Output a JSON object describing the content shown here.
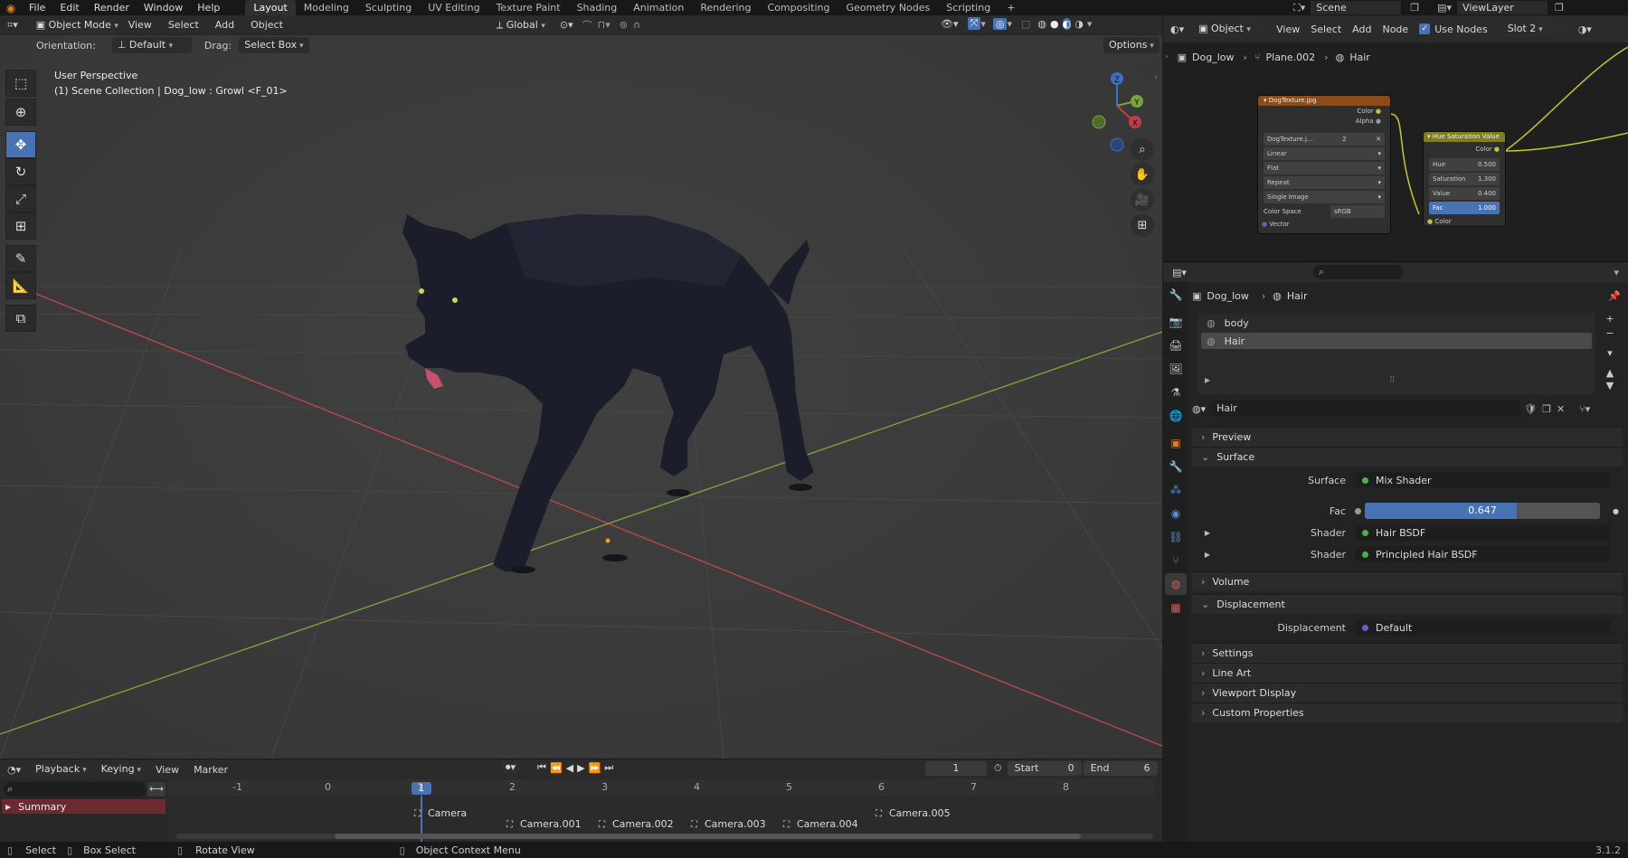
{
  "topbar": {
    "menus": [
      "File",
      "Edit",
      "Render",
      "Window",
      "Help"
    ],
    "workspaces": [
      "Layout",
      "Modeling",
      "Sculpting",
      "UV Editing",
      "Texture Paint",
      "Shading",
      "Animation",
      "Rendering",
      "Compositing",
      "Geometry Nodes",
      "Scripting"
    ],
    "active_workspace": "Layout",
    "add_tab": "+",
    "scene": "Scene",
    "view_layer": "ViewLayer"
  },
  "viewport": {
    "mode": "Object Mode",
    "menus": [
      "View",
      "Select",
      "Add",
      "Object"
    ],
    "transform": "Global",
    "orientation_label": "Orientation:",
    "orientation_value": "Default",
    "drag_label": "Drag:",
    "drag_value": "Select Box",
    "options": "Options",
    "overlay_line1": "User Perspective",
    "overlay_line2": "(1) Scene Collection | Dog_low : Growl <F_01>",
    "gizmo": {
      "x": "X",
      "y": "Y",
      "z": "Z"
    }
  },
  "timeline": {
    "menus": [
      "Playback",
      "Keying",
      "View",
      "Marker"
    ],
    "current_frame": "1",
    "start_label": "Start",
    "start": "0",
    "end_label": "End",
    "end": "6",
    "ticks": [
      "-1",
      "0",
      "1",
      "2",
      "3",
      "4",
      "5",
      "6",
      "7",
      "8"
    ],
    "summary": "Summary",
    "markers": [
      "Camera",
      "Camera.001",
      "Camera.002",
      "Camera.003",
      "Camera.004",
      "Camera.005"
    ]
  },
  "status": {
    "items": [
      "Select",
      "Box Select",
      "Rotate View",
      "Object Context Menu"
    ],
    "version": "3.1.2"
  },
  "node_editor": {
    "type": "Object",
    "menus": [
      "View",
      "Select",
      "Add",
      "Node"
    ],
    "use_nodes": "Use Nodes",
    "slot": "Slot 2",
    "breadcrumb": [
      "Dog_low",
      "Plane.002",
      "Hair"
    ],
    "image_node": {
      "title": "DogTexture.jpg",
      "outputs": [
        "Color",
        "Alpha"
      ],
      "image": "DogTexture.j...",
      "users": "2",
      "interp": "Linear",
      "proj": "Flat",
      "ext": "Repeat",
      "source": "Single Image",
      "cs_label": "Color Space",
      "cs_value": "sRGB",
      "input": "Vector"
    },
    "hsv_node": {
      "title": "Hue Saturation Value",
      "output": "Color",
      "fields": [
        {
          "label": "Hue",
          "value": "0.500"
        },
        {
          "label": "Saturation",
          "value": "1.300"
        },
        {
          "label": "Value",
          "value": "0.400"
        },
        {
          "label": "Fac",
          "value": "1.000"
        }
      ],
      "input": "Color"
    }
  },
  "properties": {
    "breadcrumb": [
      "Dog_low",
      "Hair"
    ],
    "slots": [
      "body",
      "Hair"
    ],
    "material": "Hair",
    "panels": {
      "preview": "Preview",
      "surface": "Surface",
      "volume": "Volume",
      "displacement": "Displacement",
      "settings": "Settings",
      "line_art": "Line Art",
      "viewport_display": "Viewport Display",
      "custom_props": "Custom Properties"
    },
    "surface_rows": [
      {
        "label": "Surface",
        "value": "Mix Shader"
      },
      {
        "label": "Fac",
        "value": "0.647"
      },
      {
        "label": "Shader",
        "value": "Hair BSDF"
      },
      {
        "label": "Shader",
        "value": "Principled Hair BSDF"
      }
    ],
    "fac_fraction": 0.647,
    "displacement_row": {
      "label": "Displacement",
      "value": "Default"
    }
  },
  "colors": {
    "accent": "#4772b3",
    "x_axis": "#b9474f",
    "y_axis": "#7aa33b",
    "socket_green": "#4cb04c",
    "socket_yellow": "#c7c729",
    "socket_purple": "#6363c7"
  }
}
